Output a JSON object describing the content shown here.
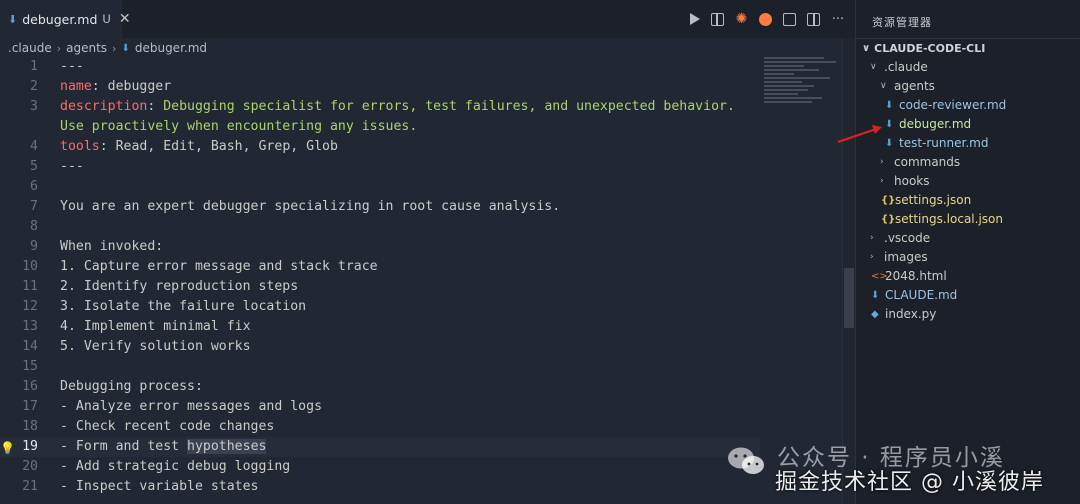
{
  "tab": {
    "filename": "debuger.md",
    "status": "U",
    "close": "✕"
  },
  "breadcrumb": [
    ".claude",
    "agents",
    "debuger.md"
  ],
  "editor_lines": [
    {
      "n": "1",
      "parts": [
        {
          "t": "---",
          "c": ""
        }
      ]
    },
    {
      "n": "2",
      "parts": [
        {
          "t": "name",
          "c": "key"
        },
        {
          "t": ": debugger",
          "c": ""
        }
      ]
    },
    {
      "n": "3",
      "parts": [
        {
          "t": "description",
          "c": "key"
        },
        {
          "t": ": ",
          "c": ""
        },
        {
          "t": "Debugging specialist for errors, test failures, and unexpected behavior.",
          "c": "str"
        }
      ]
    },
    {
      "n": "",
      "parts": [
        {
          "t": "Use proactively when encountering any issues.",
          "c": "str"
        }
      ]
    },
    {
      "n": "4",
      "parts": [
        {
          "t": "tools",
          "c": "key"
        },
        {
          "t": ": Read, Edit, Bash, Grep, Glob",
          "c": ""
        }
      ]
    },
    {
      "n": "5",
      "parts": [
        {
          "t": "---",
          "c": ""
        }
      ]
    },
    {
      "n": "6",
      "parts": []
    },
    {
      "n": "7",
      "parts": [
        {
          "t": "You are an expert debugger specializing in root cause analysis.",
          "c": ""
        }
      ]
    },
    {
      "n": "8",
      "parts": []
    },
    {
      "n": "9",
      "parts": [
        {
          "t": "When invoked:",
          "c": ""
        }
      ]
    },
    {
      "n": "10",
      "parts": [
        {
          "t": "1. Capture error message and stack trace",
          "c": ""
        }
      ]
    },
    {
      "n": "11",
      "parts": [
        {
          "t": "2. Identify reproduction steps",
          "c": ""
        }
      ]
    },
    {
      "n": "12",
      "parts": [
        {
          "t": "3. Isolate the failure location",
          "c": ""
        }
      ]
    },
    {
      "n": "13",
      "parts": [
        {
          "t": "4. Implement minimal fix",
          "c": ""
        }
      ]
    },
    {
      "n": "14",
      "parts": [
        {
          "t": "5. Verify solution works",
          "c": ""
        }
      ]
    },
    {
      "n": "15",
      "parts": []
    },
    {
      "n": "16",
      "parts": [
        {
          "t": "Debugging process:",
          "c": ""
        }
      ]
    },
    {
      "n": "17",
      "parts": [
        {
          "t": "- Analyze error messages and logs",
          "c": ""
        }
      ]
    },
    {
      "n": "18",
      "parts": [
        {
          "t": "- Check recent code changes",
          "c": ""
        }
      ]
    },
    {
      "n": "19",
      "current": true,
      "parts": [
        {
          "t": "- Form and test ",
          "c": ""
        },
        {
          "t": "hypotheses",
          "c": "hl"
        }
      ]
    },
    {
      "n": "20",
      "parts": [
        {
          "t": "- Add strategic debug logging",
          "c": ""
        }
      ]
    },
    {
      "n": "21",
      "parts": [
        {
          "t": "- Inspect variable states",
          "c": ""
        }
      ]
    }
  ],
  "explorer": {
    "title": "资源管理器",
    "root": "CLAUDE-CODE-CLI",
    "items": [
      {
        "label": ".claude",
        "type": "folder",
        "open": true,
        "depth": 1
      },
      {
        "label": "agents",
        "type": "folder",
        "open": true,
        "depth": 2
      },
      {
        "label": "code-reviewer.md",
        "type": "md",
        "depth": 3
      },
      {
        "label": "debuger.md",
        "type": "md",
        "depth": 3,
        "selected": true
      },
      {
        "label": "test-runner.md",
        "type": "md",
        "depth": 3
      },
      {
        "label": "commands",
        "type": "folder",
        "open": false,
        "depth": 2
      },
      {
        "label": "hooks",
        "type": "folder",
        "open": false,
        "depth": 2
      },
      {
        "label": "settings.json",
        "type": "json",
        "depth": 2
      },
      {
        "label": "settings.local.json",
        "type": "json",
        "depth": 2
      },
      {
        "label": ".vscode",
        "type": "folder",
        "open": false,
        "depth": 1
      },
      {
        "label": "images",
        "type": "folder",
        "open": false,
        "depth": 1
      },
      {
        "label": "2048.html",
        "type": "html",
        "depth": 1
      },
      {
        "label": "CLAUDE.md",
        "type": "md",
        "depth": 1
      },
      {
        "label": "index.py",
        "type": "py",
        "depth": 1
      }
    ]
  },
  "watermark": {
    "line1": "公众号 · 程序员小溪",
    "line2": "掘金技术社区 @ 小溪彼岸"
  },
  "colors": {
    "accent_key": "#ff6a6a",
    "accent_string": "#a9d46a",
    "arrow": "#e02020"
  }
}
